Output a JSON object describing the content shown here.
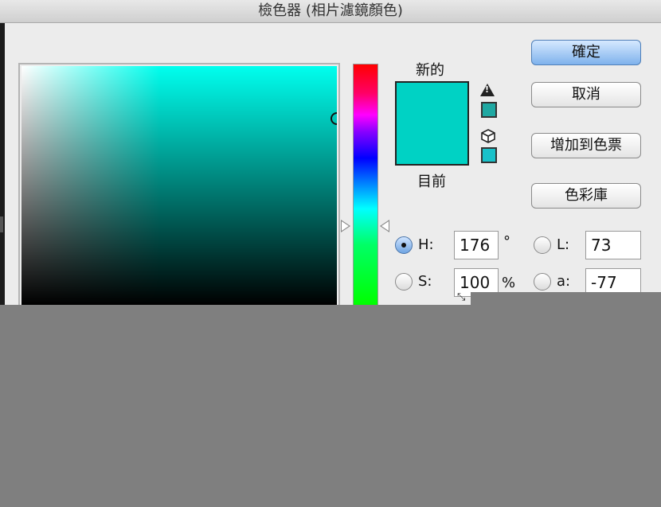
{
  "window": {
    "title": "檢色器 (相片濾鏡顏色)"
  },
  "preview": {
    "new_label": "新的",
    "current_label": "目前",
    "new_color": "#00d2c4",
    "current_color": "#00d2c4",
    "gamut_warning_icon": "warning-triangle-icon",
    "gamut_warning_color": "#1fa8a2",
    "web_safe_icon": "cube-icon",
    "web_safe_color": "#19c1c9"
  },
  "buttons": {
    "ok": "確定",
    "cancel": "取消",
    "add_to_swatches": "增加到色票",
    "color_libraries": "色彩庫"
  },
  "fields": {
    "h": {
      "label": "H:",
      "value": "176",
      "unit": "°",
      "checked": true
    },
    "s": {
      "label": "S:",
      "value": "100",
      "unit": "%",
      "checked": false
    },
    "l": {
      "label": "L:",
      "value": "73",
      "checked": false
    },
    "a": {
      "label": "a:",
      "value": "-77",
      "checked": false
    }
  },
  "colors": {
    "hue_base": "#00ffee",
    "selected": "#00d2c4"
  }
}
